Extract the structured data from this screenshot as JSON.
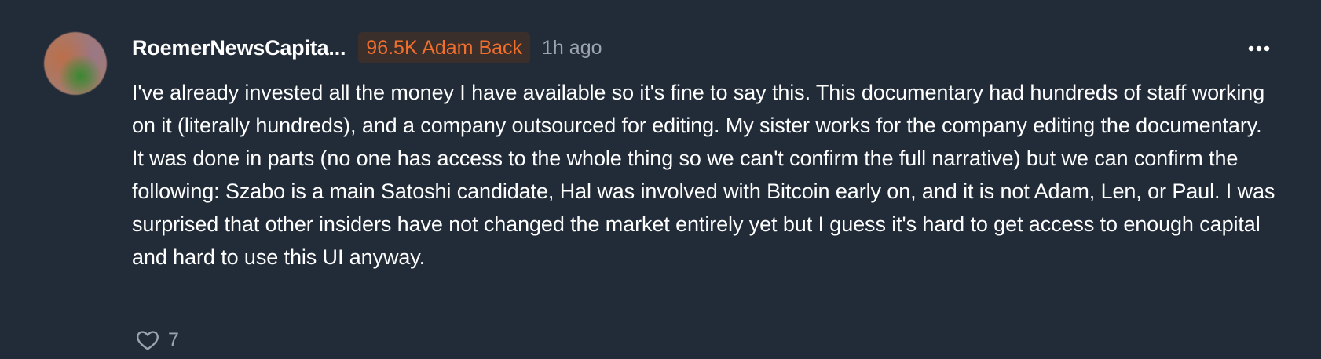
{
  "comment": {
    "author": {
      "username": "RoemerNewsCapita...",
      "avatar_icon": "avatar"
    },
    "badge": {
      "label": "96.5K Adam Back",
      "color": "#f06f2c"
    },
    "timestamp": "1h ago",
    "more_icon": "more-horizontal-icon",
    "text": "I've already invested all the money I have available so it's fine to say this. This documentary had hundreds of staff working on it (literally hundreds), and a company outsourced for editing. My sister works for the company editing the documentary. It was done in parts (no one has access to the whole thing so we can't confirm the full narrative) but we can confirm the following: Szabo is a main Satoshi candidate, Hal was involved with Bitcoin early on, and it is not Adam, Len, or Paul. I was surprised that other insiders have not changed the market entirely yet but I guess it's hard to get access to enough capital and hard to use this UI anyway.",
    "likes": {
      "icon": "heart-icon",
      "count": "7"
    }
  },
  "colors": {
    "background": "#222c39",
    "text_primary": "#ffffff",
    "text_secondary": "#9aa3af",
    "badge_background": "#3b2f2c",
    "accent": "#f06f2c"
  }
}
